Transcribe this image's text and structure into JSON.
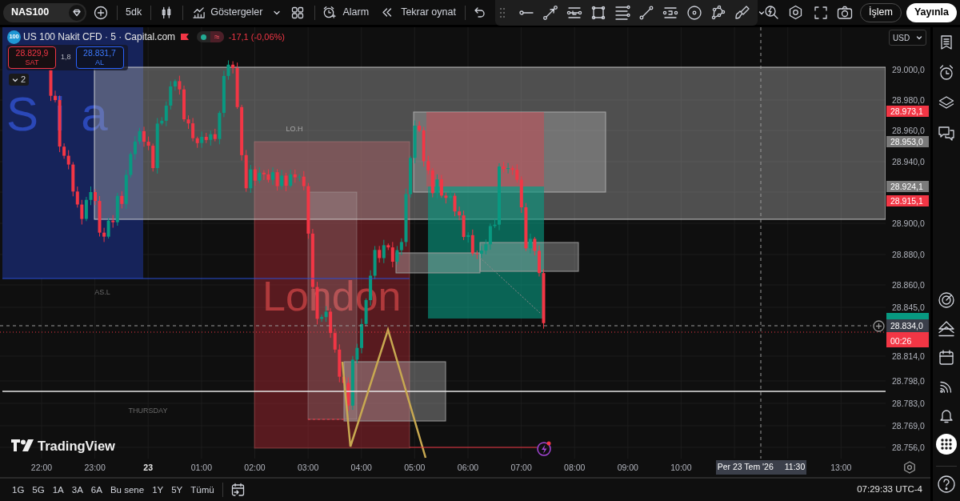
{
  "toolbar": {
    "symbol": "NAS100",
    "interval": "5dk",
    "indicators": "Göstergeler",
    "alert": "Alarm",
    "replay": "Tekrar oynat",
    "trade": "İşlem",
    "publish": "Yayınla"
  },
  "legend": {
    "badge": "100",
    "title": "US 100 Nakit CFD · 5 · Capital.com",
    "status_symbol": "≈",
    "change": "-17,1 (-0,06%)",
    "sell_price": "28.829,9",
    "sell_label": "SAT",
    "spread": "1,8",
    "buy_price": "28.831,7",
    "buy_label": "AL",
    "collapsed_count": "2"
  },
  "chart": {
    "asia_label": "Sia",
    "london_label": "London",
    "high_label": "LO.H",
    "low_label": "AS.L",
    "day_label": "THURSDAY",
    "logo": "TradingView"
  },
  "price_axis": {
    "currency": "USD",
    "labels": [
      "29.000,0",
      "28.980,0",
      "28.960,0",
      "28.940,0",
      "28.900,0",
      "28.880,0",
      "28.860,0",
      "28.845,0",
      "28.814,0",
      "28.798,0",
      "28.783,0",
      "28.769,0",
      "28.756,0"
    ],
    "tags": [
      {
        "text": "28.973,1",
        "color": "#f23645"
      },
      {
        "text": "28.953,0",
        "color": "#7b7b7b"
      },
      {
        "text": "28.924,1",
        "color": "#7b7b7b"
      },
      {
        "text": "28.915,1",
        "color": "#f23645"
      },
      {
        "color": "#089981"
      }
    ],
    "crosshair_price": "28.834,0",
    "countdown": "00:26"
  },
  "time_axis": {
    "labels": [
      {
        "text": "22:00",
        "kind": "time"
      },
      {
        "text": "23:00",
        "kind": "time"
      },
      {
        "text": "23",
        "kind": "date"
      },
      {
        "text": "01:00",
        "kind": "time"
      },
      {
        "text": "02:00",
        "kind": "time"
      },
      {
        "text": "03:00",
        "kind": "time"
      },
      {
        "text": "04:00",
        "kind": "time"
      },
      {
        "text": "05:00",
        "kind": "time"
      },
      {
        "text": "06:00",
        "kind": "time"
      },
      {
        "text": "07:00",
        "kind": "time"
      },
      {
        "text": "08:00",
        "kind": "time"
      },
      {
        "text": "09:00",
        "kind": "time"
      },
      {
        "text": "10:00",
        "kind": "time"
      },
      {
        "text": "13:00",
        "kind": "time"
      }
    ],
    "crosshair_date": "Per 23 Tem '26",
    "crosshair_time": "11:30"
  },
  "bottom_bar": {
    "ranges": [
      {
        "label": "1G",
        "selected": false
      },
      {
        "label": "5G",
        "selected": false
      },
      {
        "label": "1A",
        "selected": false
      },
      {
        "label": "3A",
        "selected": false
      },
      {
        "label": "6A",
        "selected": false
      },
      {
        "label": "Bu sene",
        "selected": false
      },
      {
        "label": "1Y",
        "selected": false
      },
      {
        "label": "5Y",
        "selected": false
      },
      {
        "label": "Tümü",
        "selected": false
      }
    ],
    "clock": "07:29:33 UTC-4"
  },
  "sidebar": {
    "buttons": [
      {
        "selected": false
      },
      {
        "selected": false
      },
      {
        "selected": false
      },
      {
        "selected": false
      },
      {
        "selected": false
      },
      {
        "selected": false
      },
      {
        "selected": false
      },
      {
        "selected": false
      },
      {
        "selected": false
      },
      {
        "selected": true
      },
      {
        "selected": false
      }
    ]
  }
}
